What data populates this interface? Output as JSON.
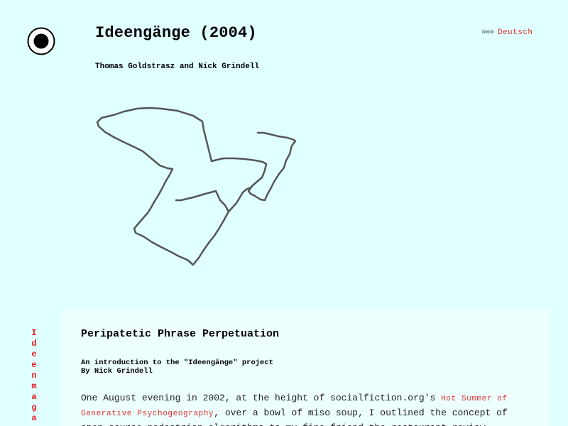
{
  "header": {
    "title": "Ideengänge (2004)",
    "authors": "Thomas Goldstrasz and Nick Grindell",
    "lang_arrows": "»»»",
    "lang_link": "Deutsch"
  },
  "logo": {
    "icon": "target-circle-icon"
  },
  "drawing": {
    "icon": "walk-route-path-drawing",
    "stroke_color": "#555555"
  },
  "side_nav": {
    "letters": [
      "I",
      "d",
      "e",
      "e",
      "n",
      "m",
      "a",
      "g",
      "a"
    ]
  },
  "article": {
    "heading": "Peripatetic Phrase Perpetuation",
    "intro_line1": "An introduction to the \"Ideengänge\" project",
    "intro_line2": "By Nick Grindell",
    "para_start": "One August evening in 2002, at the height of socialfiction.org's ",
    "para_link": "Hot Summer of Generative Psychogeography",
    "para_end": ", over a bowl of miso soup, I outlined the concept of open-source pedestrian algorithms to my fine friend the restaurant review"
  },
  "colors": {
    "background": "#e0ffff",
    "content_background": "#eeffff",
    "link": "#e0332b",
    "side_nav": "#e41a1c"
  }
}
